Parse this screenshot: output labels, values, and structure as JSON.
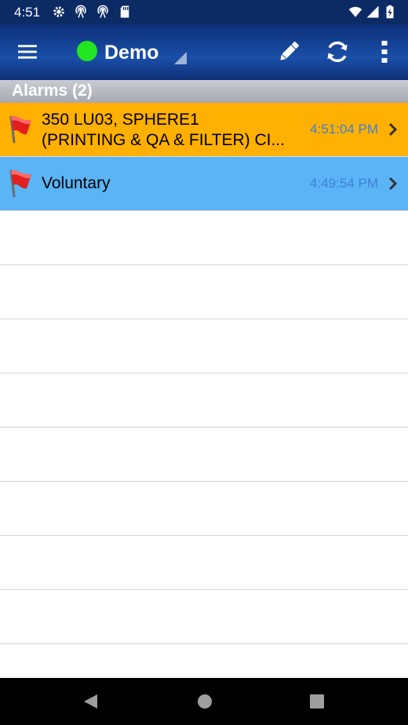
{
  "status_bar": {
    "time": "4:51"
  },
  "app_bar": {
    "connection_color": "#21e621",
    "title": "Demo",
    "icons": [
      "menu-icon",
      "pencil-icon",
      "refresh-icon",
      "more-vert-icon"
    ]
  },
  "section": {
    "title": "Alarms (2)"
  },
  "alarms": [
    {
      "line1": "350 LU03, SPHERE1",
      "line2": "(PRINTING & QA & FILTER) CI...",
      "time": "4:51:04 PM",
      "color": "#ffb000"
    },
    {
      "line1": "Voluntary",
      "time": "4:49:54 PM",
      "color": "#5bb4f5"
    }
  ]
}
